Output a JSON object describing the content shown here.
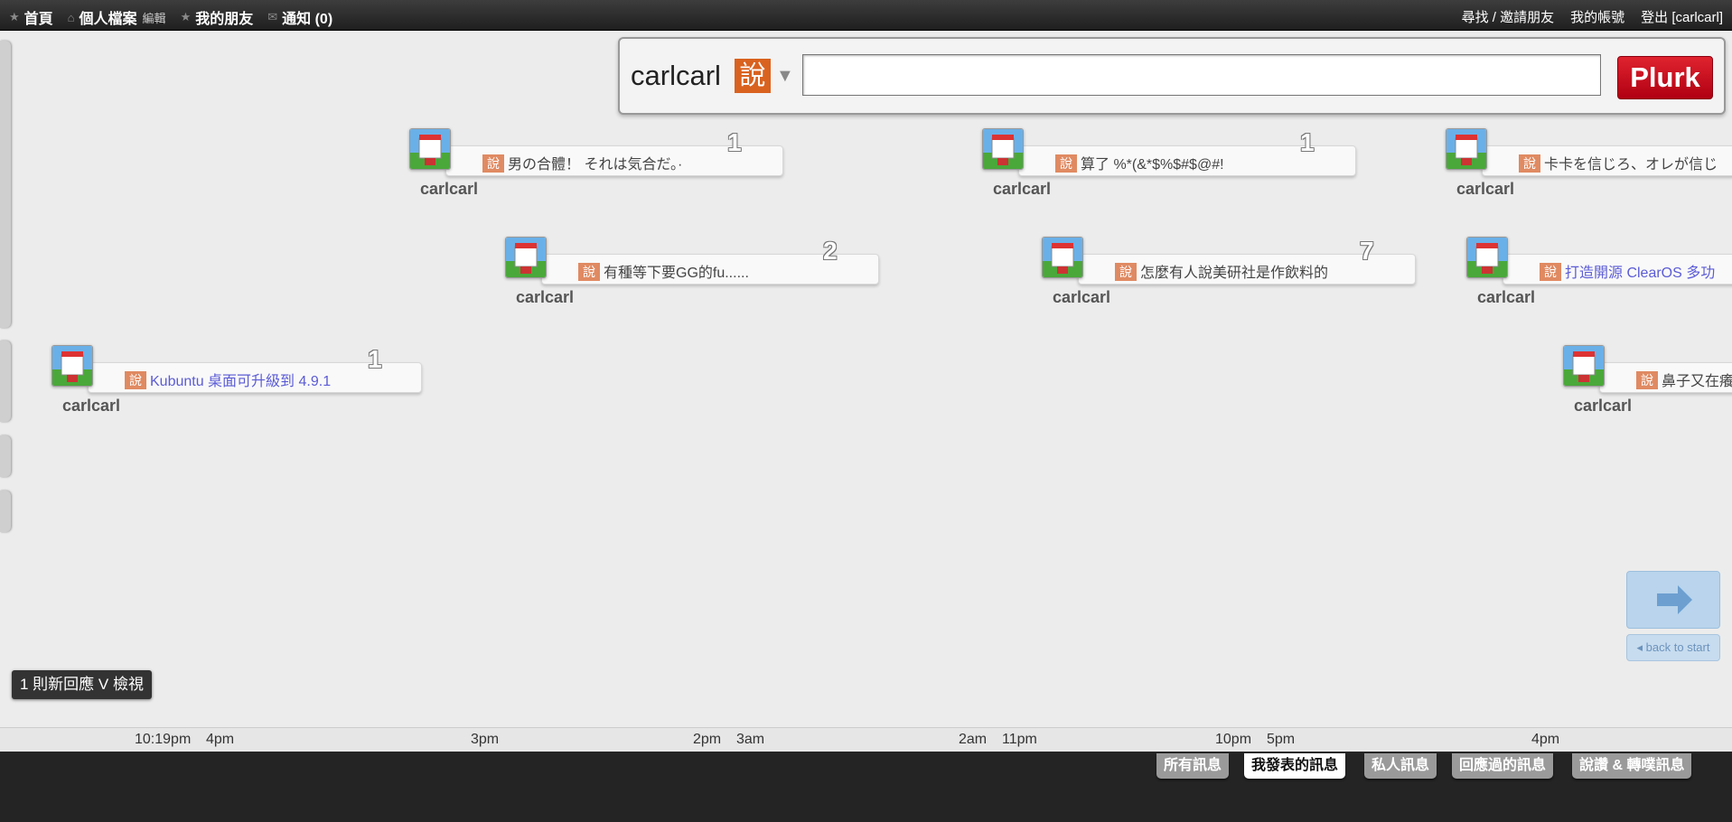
{
  "topbar": {
    "nav": [
      {
        "icon": "star-icon",
        "label": "首頁"
      },
      {
        "icon": "home-icon",
        "label": "個人檔案",
        "extra": "編輯"
      },
      {
        "icon": "star-icon",
        "label": "我的朋友"
      },
      {
        "icon": "mail-icon",
        "label": "通知 (0)"
      }
    ],
    "right": [
      "尋找 / 邀請朋友",
      "我的帳號",
      "登出 [carlcarl]"
    ]
  },
  "composer": {
    "username": "carlcarl",
    "qualifier": "說",
    "input_value": "",
    "submit_label": "Plurk"
  },
  "plurks": [
    {
      "text": "男の合體！ それは気合だ。·",
      "count": "1",
      "user": "carlcarl",
      "link": false
    },
    {
      "text": "算了 %*(&*$%$#$@#!",
      "count": "1",
      "user": "carlcarl",
      "link": false
    },
    {
      "text": "卡卡を信じろ、オレが信じ",
      "count": "",
      "user": "carlcarl",
      "link": false
    },
    {
      "text": "有種等下要GG的fu......",
      "count": "2",
      "user": "carlcarl",
      "link": false
    },
    {
      "text": "怎麼有人說美研社是作飲料的",
      "count": "7",
      "user": "carlcarl",
      "link": false
    },
    {
      "text": "打造開源 ClearOS 多功",
      "count": "",
      "user": "carlcarl",
      "link": true
    },
    {
      "text": "Kubuntu 桌面可升級到 4.9.1",
      "count": "1",
      "user": "carlcarl",
      "link": true
    },
    {
      "text": "鼻子又在癢",
      "count": "",
      "user": "carlcarl",
      "link": false
    }
  ],
  "qualifier_label": "說",
  "nav": {
    "back_start": "back to start"
  },
  "new_responses": "1 則新回應 V 檢視",
  "timeline_ticks": [
    "10:19pm",
    "4pm",
    "3pm",
    "2pm",
    "3am",
    "2am",
    "11pm",
    "10pm",
    "5pm",
    "4pm"
  ],
  "filter_tabs": [
    "所有訊息",
    "我發表的訊息",
    "私人訊息",
    "回應過的訊息",
    "說讚 & 轉噗訊息"
  ],
  "active_filter_tab": "我發表的訊息",
  "colors": {
    "qualifier": "#d9621f",
    "plurk_button": "#c4101e",
    "link_text": "#5b5bd6"
  }
}
